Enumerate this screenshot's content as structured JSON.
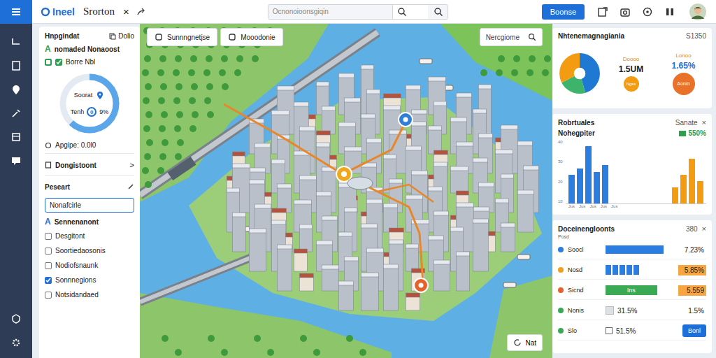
{
  "app": {
    "logo": "Ineel",
    "title": "Srorton",
    "close": "×"
  },
  "search": {
    "placeholder": "Ocnonoioonsgiqin"
  },
  "top_button": "Boonse",
  "left_panel": {
    "header": {
      "title": "Hnpgindat",
      "action": "Dolio"
    },
    "section": {
      "badge": "A",
      "title": "nomaded Nonaoost"
    },
    "check_item": {
      "label": "Borre Nbl",
      "checked": true
    },
    "donut": {
      "level": 0.62,
      "top_label": "Soorat",
      "bottom_label": "Tenh",
      "center": "0",
      "value": "9%"
    },
    "stat": "Apgipe: 0.0l0",
    "nav_items": [
      {
        "label": "Dongistoont",
        "kind": "chevron",
        "mark": ">"
      },
      {
        "label": "Peseart",
        "kind": "edit",
        "mark": ""
      }
    ],
    "input": {
      "value": "Nonafcirle"
    },
    "list_title": {
      "badge": "A",
      "title": "Sennenanont"
    },
    "list": [
      {
        "label": "Desgitont",
        "checked": false
      },
      {
        "label": "Soortiedaosonis",
        "checked": false
      },
      {
        "label": "Nodiofsnaunk",
        "checked": false
      },
      {
        "label": "Sonnnegions",
        "checked": true
      },
      {
        "label": "Notsidandaed",
        "checked": false
      }
    ]
  },
  "map": {
    "tabs": [
      {
        "label": "Sunnngnetjse",
        "selected": false
      },
      {
        "label": "Mooodonie",
        "selected": false
      }
    ],
    "search": {
      "placeholder": "Nercgiome"
    },
    "button": "Nat"
  },
  "overview_card": {
    "title": "Nhtenemagnagiania",
    "value": "S1350",
    "pie": [
      {
        "value": 45,
        "color": "#1f78d1"
      },
      {
        "value": 22,
        "color": "#3db36b"
      },
      {
        "value": 33,
        "color": "#f39c12"
      }
    ],
    "stats": [
      {
        "label": "Doooo",
        "value": "1.5UM",
        "badge": "Ngss"
      },
      {
        "label": "Lonoo",
        "value": "1.65%",
        "badge": "Aonm"
      }
    ]
  },
  "bars_card": {
    "title": "Robrtuales",
    "filter": "Sanate",
    "close": "×",
    "subtitle": "Nohegpiter",
    "legend": "550%",
    "ticks": [
      "40",
      "30",
      "20",
      "10"
    ],
    "x_labels": [
      "Jus",
      "Jus",
      "Jus",
      "Jus",
      "Jus"
    ],
    "series": [
      {
        "name": "blue",
        "color": "#2b7de0",
        "values": [
          18,
          22,
          36,
          20,
          24
        ]
      },
      {
        "name": "orange",
        "color": "#f39c12",
        "values": [
          10,
          18,
          28,
          14
        ]
      }
    ]
  },
  "list_card": {
    "title": "Doceinengloonts",
    "count": "380",
    "close": "×",
    "subtitle": "Posd",
    "rows": [
      {
        "label": "Soocl",
        "color": "#2b7de0",
        "kind": "bar",
        "level": 0.85,
        "bar_color": "#2b7de0",
        "text": "",
        "value": "7.23%",
        "highlight": false,
        "button": ""
      },
      {
        "label": "Nosd",
        "color": "#f0a020",
        "kind": "segments",
        "level": 0.85,
        "bar_color": "#2b7de0",
        "text": "",
        "value": "5.85%",
        "highlight": true,
        "button": ""
      },
      {
        "label": "Sicnd",
        "color": "#e8602c",
        "kind": "tag",
        "level": 0.75,
        "bar_color": "#3aaa55",
        "text": "Ins",
        "value": "5.559",
        "highlight": true,
        "button": ""
      },
      {
        "label": "Nonis",
        "color": "#3aaa55",
        "kind": "box",
        "level": 0,
        "bar_color": "#dde1e6",
        "text": "31.5%",
        "value": "1.5%",
        "highlight": false,
        "button": ""
      },
      {
        "label": "Slo",
        "color": "#3aaa55",
        "kind": "check",
        "level": 0,
        "bar_color": "#ffffff",
        "text": "51.5%",
        "value": "",
        "highlight": false,
        "button": "Bonl"
      }
    ]
  }
}
